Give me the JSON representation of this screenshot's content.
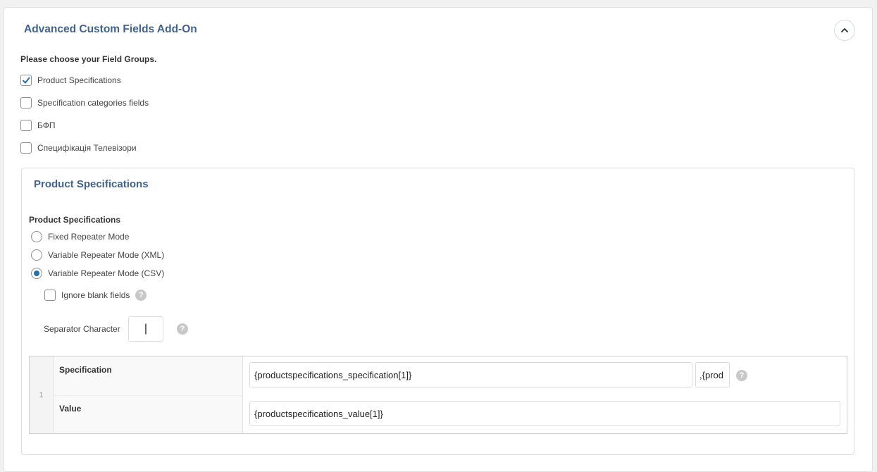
{
  "panel": {
    "title": "Advanced Custom Fields Add-On",
    "collapse_icon": "chevron-up-icon"
  },
  "field_groups": {
    "prompt": "Please choose your Field Groups.",
    "items": [
      {
        "label": "Product Specifications",
        "checked": true
      },
      {
        "label": "Specification categories fields",
        "checked": false
      },
      {
        "label": "БФП",
        "checked": false
      },
      {
        "label": "Специфікація Телевізори",
        "checked": false
      }
    ]
  },
  "group": {
    "title": "Product Specifications",
    "field_label": "Product Specifications",
    "modes": [
      {
        "label": "Fixed Repeater Mode",
        "selected": false
      },
      {
        "label": "Variable Repeater Mode (XML)",
        "selected": false
      },
      {
        "label": "Variable Repeater Mode (CSV)",
        "selected": true
      }
    ],
    "ignore_blank": {
      "label": "Ignore blank fields",
      "checked": false
    },
    "separator": {
      "label": "Separator Character",
      "value": "|"
    },
    "help_icon": "?",
    "repeater": {
      "row_index": "1",
      "rows": [
        {
          "label": "Specification",
          "value": "{productspecifications_specification[1]}",
          "extra": ",{prod"
        },
        {
          "label": "Value",
          "value": "{productspecifications_value[1]}"
        }
      ]
    }
  },
  "colors": {
    "title": "#40638e",
    "accent": "#2271b1"
  }
}
